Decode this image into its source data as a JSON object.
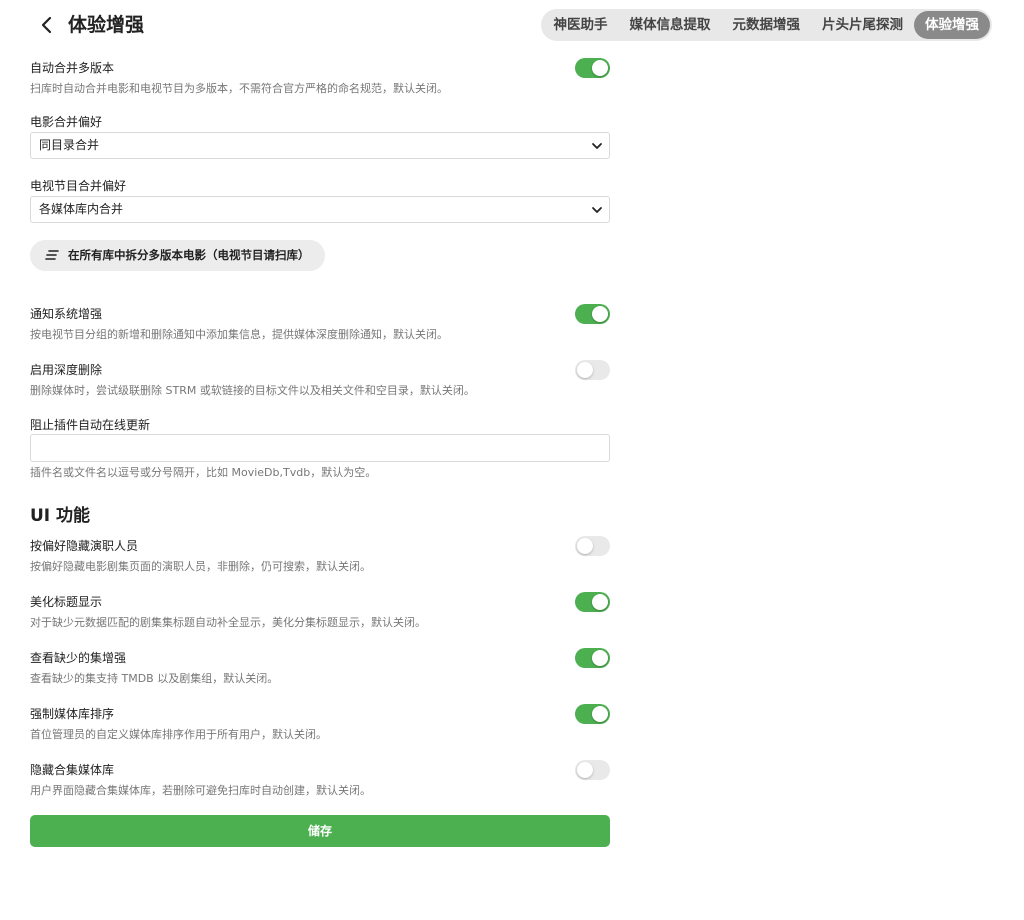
{
  "header": {
    "title": "体验增强",
    "tabs": [
      {
        "label": "神医助手",
        "active": false
      },
      {
        "label": "媒体信息提取",
        "active": false
      },
      {
        "label": "元数据增强",
        "active": false
      },
      {
        "label": "片头片尾探测",
        "active": false
      },
      {
        "label": "体验增强",
        "active": true
      }
    ]
  },
  "settings": {
    "auto_merge": {
      "label": "自动合并多版本",
      "desc": "扫库时自动合并电影和电视节目为多版本，不需符合官方严格的命名规范，默认关闭。",
      "enabled": true
    },
    "movie_pref": {
      "label": "电影合并偏好",
      "value": "同目录合并"
    },
    "tv_pref": {
      "label": "电视节目合并偏好",
      "value": "各媒体库内合并"
    },
    "split_button": {
      "label": "在所有库中拆分多版本电影（电视节目请扫库）"
    },
    "notify": {
      "label": "通知系统增强",
      "desc": "按电视节目分组的新增和删除通知中添加集信息，提供媒体深度删除通知，默认关闭。",
      "enabled": true
    },
    "deep_delete": {
      "label": "启用深度删除",
      "desc": "删除媒体时，尝试级联删除 STRM 或软链接的目标文件以及相关文件和空目录，默认关闭。",
      "enabled": false
    },
    "block_update": {
      "label": "阻止插件自动在线更新",
      "value": "",
      "desc": "插件名或文件名以逗号或分号隔开，比如 MovieDb,Tvdb，默认为空。"
    }
  },
  "ui_section": {
    "title": "UI 功能",
    "items": [
      {
        "label": "按偏好隐藏演职人员",
        "desc": "按偏好隐藏电影剧集页面的演职人员，非删除，仍可搜索，默认关闭。",
        "enabled": false
      },
      {
        "label": "美化标题显示",
        "desc": "对于缺少元数据匹配的剧集集标题自动补全显示，美化分集标题显示，默认关闭。",
        "enabled": true
      },
      {
        "label": "查看缺少的集增强",
        "desc": "查看缺少的集支持 TMDB 以及剧集组，默认关闭。",
        "enabled": true
      },
      {
        "label": "强制媒体库排序",
        "desc": "首位管理员的自定义媒体库排序作用于所有用户，默认关闭。",
        "enabled": true
      },
      {
        "label": "隐藏合集媒体库",
        "desc": "用户界面隐藏合集媒体库，若删除可避免扫库时自动创建，默认关闭。",
        "enabled": false
      }
    ]
  },
  "save_label": "储存",
  "colors": {
    "accent": "#4caf50",
    "tab_active": "#8a8a8a",
    "toggle_off": "#e9e9e9"
  }
}
